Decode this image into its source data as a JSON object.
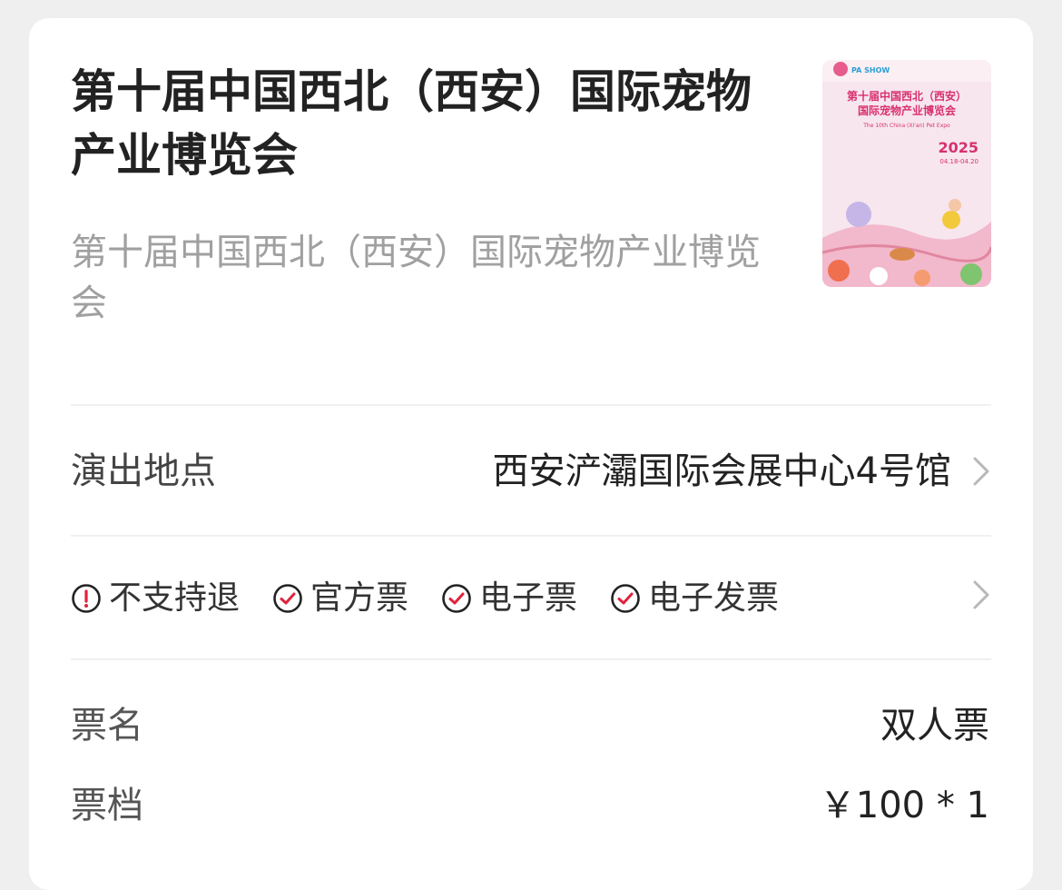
{
  "event": {
    "title": "第十届中国西北（西安）国际宠物产业博览会",
    "subtitle": "第十届中国西北（西安）国际宠物产业博览会"
  },
  "poster": {
    "brand": "PA SHOW",
    "title_line1": "第十届中国西北（西安）",
    "title_line2": "国际宠物产业博览会",
    "english": "The 10th China (Xi'an) Pet Expo",
    "year": "2025",
    "dates": "04.18-04.20"
  },
  "venue": {
    "label": "演出地点",
    "value": "西安浐灞国际会展中心4号馆"
  },
  "tags": [
    {
      "icon": "exclamation-circle-icon",
      "label": "不支持退"
    },
    {
      "icon": "check-circle-icon",
      "label": "官方票"
    },
    {
      "icon": "check-circle-icon",
      "label": "电子票"
    },
    {
      "icon": "check-circle-icon",
      "label": "电子发票"
    }
  ],
  "ticket": {
    "name_label": "票名",
    "name_value": "双人票",
    "tier_label": "票档",
    "tier_value": "￥100 * 1"
  },
  "colors": {
    "accent": "#e0233c",
    "text_primary": "#222222",
    "text_secondary": "#a0a0a0"
  }
}
